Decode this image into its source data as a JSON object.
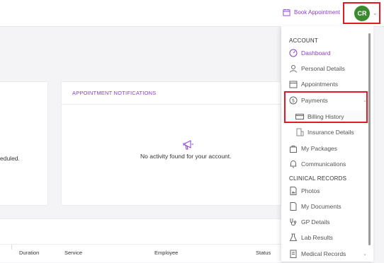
{
  "topbar": {
    "book_appointment": "Book Appointment",
    "avatar_initials": "CR",
    "avatar_color": "#3b8a2f",
    "accent": "#8a3fd1"
  },
  "left_card": {
    "scheduled_text": "eduled."
  },
  "notifications": {
    "title": "APPOINTMENT NOTIFICATIONS",
    "empty_text": "No activity found for your account."
  },
  "table": {
    "columns": [
      "Duration",
      "Service",
      "Employee",
      "Status"
    ]
  },
  "menu": {
    "account_title": "ACCOUNT",
    "clinical_title": "CLINICAL RECORDS",
    "items": [
      {
        "label": "Dashboard",
        "icon": "speedometer-icon"
      },
      {
        "label": "Personal Details",
        "icon": "person-icon"
      },
      {
        "label": "Appointments",
        "icon": "calendar-icon"
      },
      {
        "label": "Payments",
        "icon": "dollar-circle-icon"
      },
      {
        "label": "Billing History",
        "icon": "card-icon"
      },
      {
        "label": "Insurance Details",
        "icon": "building-icon"
      },
      {
        "label": "My Packages",
        "icon": "bag-icon"
      },
      {
        "label": "Communications",
        "icon": "bell-icon"
      },
      {
        "label": "Photos",
        "icon": "photo-file-icon"
      },
      {
        "label": "My Documents",
        "icon": "document-icon"
      },
      {
        "label": "GP Details",
        "icon": "stethoscope-icon"
      },
      {
        "label": "Lab Results",
        "icon": "flask-icon"
      },
      {
        "label": "Medical Records",
        "icon": "records-icon"
      }
    ]
  }
}
